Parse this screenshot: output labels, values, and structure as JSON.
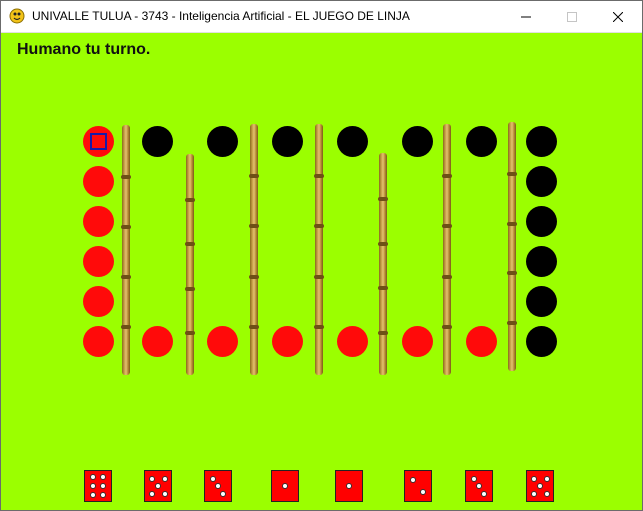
{
  "window": {
    "title": "UNIVALLE TULUA - 3743 - Inteligencia Artificial - EL JUEGO DE LINJA",
    "icon": "python-snake-icon",
    "controls": [
      "minimize-icon",
      "maximize-icon",
      "close-icon"
    ]
  },
  "status": {
    "message": "Humano tu turno."
  },
  "colors": {
    "background": "#9bff00",
    "red_piece": "#ff0a0a",
    "black_piece": "#000000",
    "selector": "#1a1aa8",
    "die": "#ff0000"
  },
  "board": {
    "columns": 8,
    "rows": 6,
    "column_pieces": [
      [
        "red",
        "red",
        "red",
        "red",
        "red",
        "red"
      ],
      [
        "black",
        "",
        "",
        "",
        "",
        "red"
      ],
      [
        "black",
        "",
        "",
        "",
        "",
        "red"
      ],
      [
        "black",
        "",
        "",
        "",
        "",
        "red"
      ],
      [
        "black",
        "",
        "",
        "",
        "",
        "red"
      ],
      [
        "black",
        "",
        "",
        "",
        "",
        "red"
      ],
      [
        "black",
        "",
        "",
        "",
        "",
        "red"
      ],
      [
        "black",
        "black",
        "black",
        "black",
        "black",
        "black"
      ]
    ],
    "selected": {
      "column": 0,
      "row": 0
    }
  },
  "dice": [
    6,
    5,
    3,
    1,
    1,
    2,
    3,
    5
  ]
}
